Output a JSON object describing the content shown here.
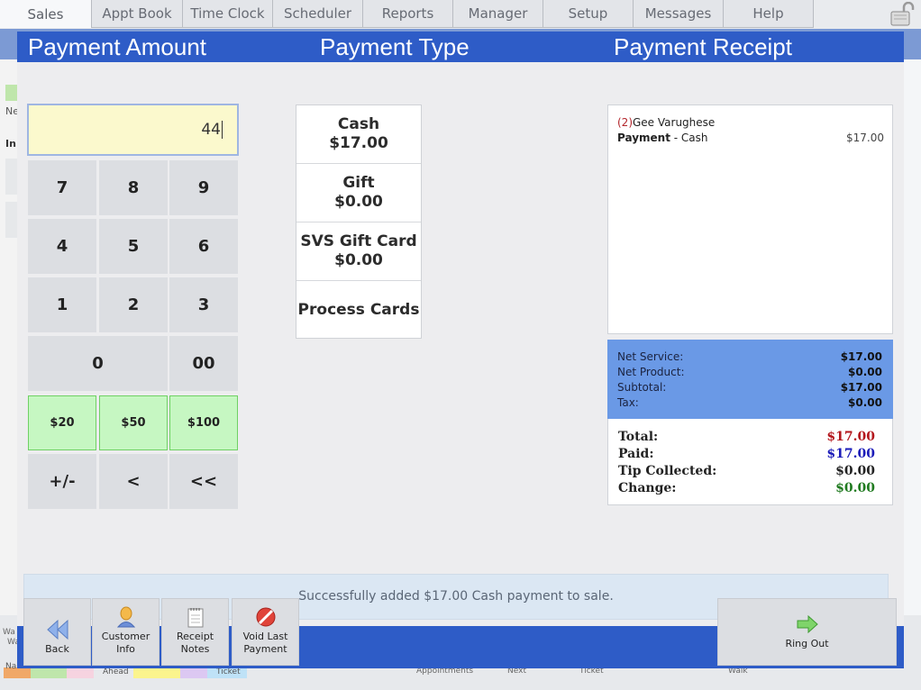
{
  "nav": {
    "tabs": [
      "Sales",
      "Appt Book",
      "Time Clock",
      "Scheduler",
      "Reports",
      "Manager",
      "Setup",
      "Messages",
      "Help"
    ],
    "lock_icon": "lock-icon"
  },
  "background": {
    "left_labels": [
      "Ne",
      "In"
    ],
    "bottom_labels": [
      "Wa",
      "Wa",
      "Na",
      "Ahead",
      "Ticket",
      "Appointments",
      "Next",
      "Ticket",
      "Walk"
    ]
  },
  "sections": {
    "amount_title": "Payment Amount",
    "type_title": "Payment Type",
    "receipt_title": "Payment Receipt"
  },
  "amount": {
    "value": "44"
  },
  "keypad": [
    {
      "label": "7"
    },
    {
      "label": "8"
    },
    {
      "label": "9"
    },
    {
      "label": "4"
    },
    {
      "label": "5"
    },
    {
      "label": "6"
    },
    {
      "label": "1"
    },
    {
      "label": "2"
    },
    {
      "label": "3"
    },
    {
      "label": "0"
    },
    {
      "label": "00"
    },
    {
      "label": "$20"
    },
    {
      "label": "$50"
    },
    {
      "label": "$100"
    },
    {
      "label": "+/-"
    },
    {
      "label": "<"
    },
    {
      "label": "<<"
    }
  ],
  "payment_types": [
    {
      "label": "Cash",
      "amount": "$17.00"
    },
    {
      "label": "Gift",
      "amount": "$0.00"
    },
    {
      "label": "SVS Gift Card",
      "amount": "$0.00"
    },
    {
      "label": "Process Cards",
      "amount": ""
    }
  ],
  "receipt": {
    "client_number": "(2)",
    "client_name": "Gee Varughese",
    "payment_label": "Payment",
    "payment_method": " - Cash",
    "payment_amount": "$17.00"
  },
  "totals": {
    "net_service_label": "Net Service:",
    "net_service": "$17.00",
    "net_product_label": "Net Product:",
    "net_product": "$0.00",
    "subtotal_label": "Subtotal:",
    "subtotal": "$17.00",
    "tax_label": "Tax:",
    "tax": "$0.00",
    "total_label": "Total:",
    "total": "$17.00",
    "paid_label": "Paid:",
    "paid": "$17.00",
    "tip_label": "Tip Collected:",
    "tip": "$0.00",
    "change_label": "Change:",
    "change": "$0.00"
  },
  "colors": {
    "total": "#b3161c",
    "paid": "#1a1ab8",
    "change": "#1f7a1f",
    "accent": "#2e5cc7"
  },
  "status_message": "Successfully added $17.00 Cash payment to sale.",
  "footer": {
    "back": "Back",
    "customer_info_1": "Customer",
    "customer_info_2": "Info",
    "receipt_notes_1": "Receipt",
    "receipt_notes_2": "Notes",
    "void_1": "Void Last",
    "void_2": "Payment",
    "ring_out": "Ring Out"
  }
}
